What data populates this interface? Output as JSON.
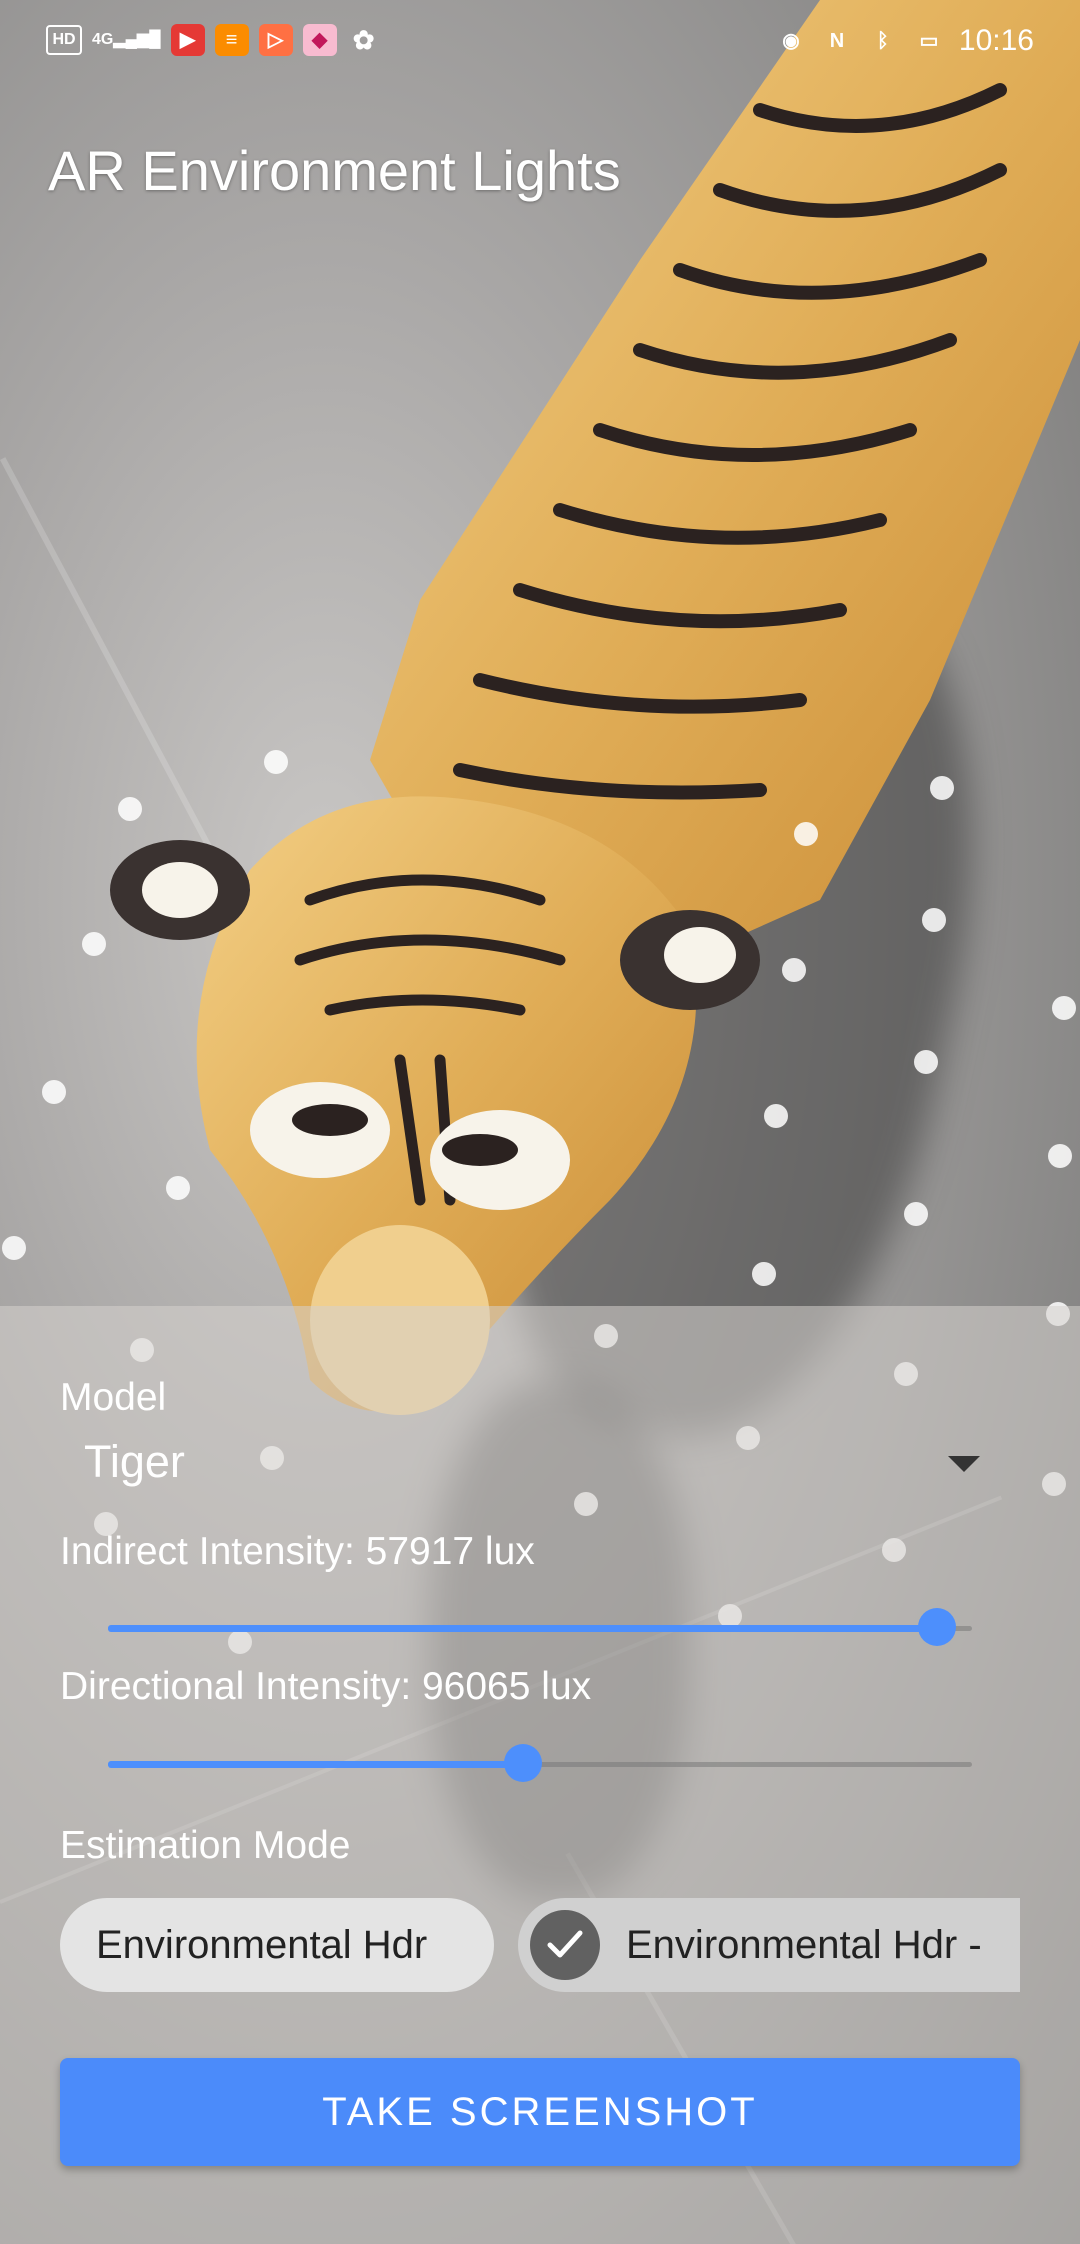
{
  "status_bar": {
    "hd_badge": "HD",
    "network": "4G",
    "time": "10:16"
  },
  "app": {
    "title": "AR Environment Lights"
  },
  "controls": {
    "model_label": "Model",
    "model_value": "Tiger",
    "indirect_label": "Indirect Intensity: 57917 lux",
    "indirect_level": 0.96,
    "directional_label": "Directional Intensity: 96065 lux",
    "directional_level": 0.48,
    "estimation_label": "Estimation Mode",
    "estimation_options": [
      {
        "label": "Environmental Hdr",
        "selected": false
      },
      {
        "label": "Environmental Hdr -",
        "selected": true
      }
    ],
    "take_screenshot_label": "TAKE SCREENSHOT"
  },
  "colors": {
    "accent": "#4b8bfa",
    "slider": "#4d8ffc"
  }
}
